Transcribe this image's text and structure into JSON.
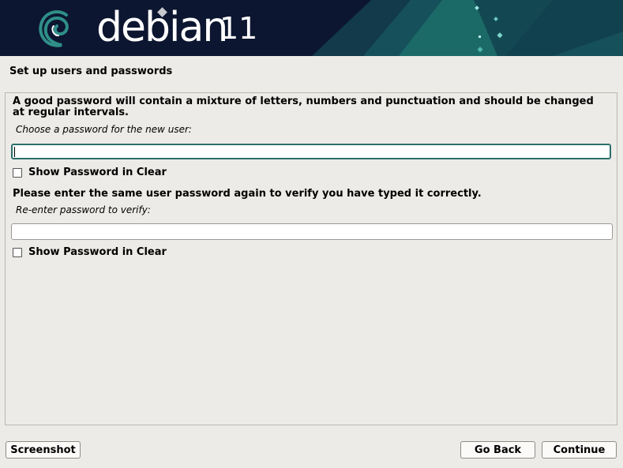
{
  "banner": {
    "brand": "debian",
    "version": "11",
    "logo_icon": "debian-swirl-icon",
    "colors": {
      "background": "#0c1630",
      "accent": "#1f6f6b"
    }
  },
  "page": {
    "title": "Set up users and passwords"
  },
  "form": {
    "intro": "A good password will contain a mixture of letters, numbers and punctuation and should be changed at regular intervals.",
    "password_prompt": "Choose a password for the new user:",
    "password_value": "",
    "show_password_label": "Show Password in Clear",
    "verify_text": "Please enter the same user password again to verify you have typed it correctly.",
    "verify_prompt": "Re-enter password to verify:",
    "verify_value": "",
    "show_password_label_2": "Show Password in Clear"
  },
  "buttons": {
    "screenshot": "Screenshot",
    "go_back": "Go Back",
    "continue": "Continue"
  }
}
